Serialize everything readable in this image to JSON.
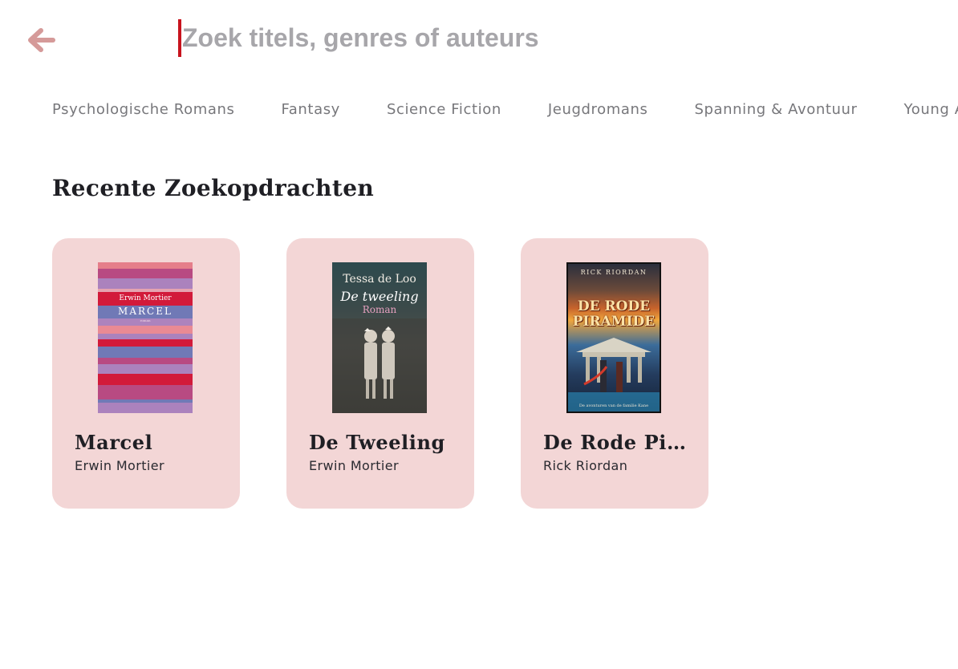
{
  "search": {
    "placeholder": "Zoek titels, genres of auteurs",
    "value": ""
  },
  "header": {
    "back_icon": "arrow-left-icon",
    "accent_color": "#d59a99",
    "caret_color": "#c8141e"
  },
  "genres": [
    {
      "label": "Psychologische Romans"
    },
    {
      "label": "Fantasy"
    },
    {
      "label": "Science Fiction"
    },
    {
      "label": "Jeugdromans"
    },
    {
      "label": "Spanning & Avontuur"
    },
    {
      "label": "Young Adult"
    }
  ],
  "recent": {
    "title": "Recente Zoekopdrachten",
    "card_color": "#f3d6d6",
    "items": [
      {
        "title": "Marcel",
        "author": "Erwin Mortier",
        "cover": {
          "author": "Erwin Mortier",
          "title": "MARCEL",
          "sub": "roman"
        }
      },
      {
        "title": "De Tweeling",
        "author": "Erwin Mortier",
        "cover": {
          "author": "Tessa de Loo",
          "title": "De tweeling",
          "sub": "Roman"
        }
      },
      {
        "title": "De Rode Piramide",
        "author": "Rick Riordan",
        "cover": {
          "author": "RICK RIORDAN",
          "title_line1": "DE RODE",
          "title_line2": "PIRAMIDE",
          "sub": "De avonturen van de familie Kane"
        }
      }
    ]
  }
}
